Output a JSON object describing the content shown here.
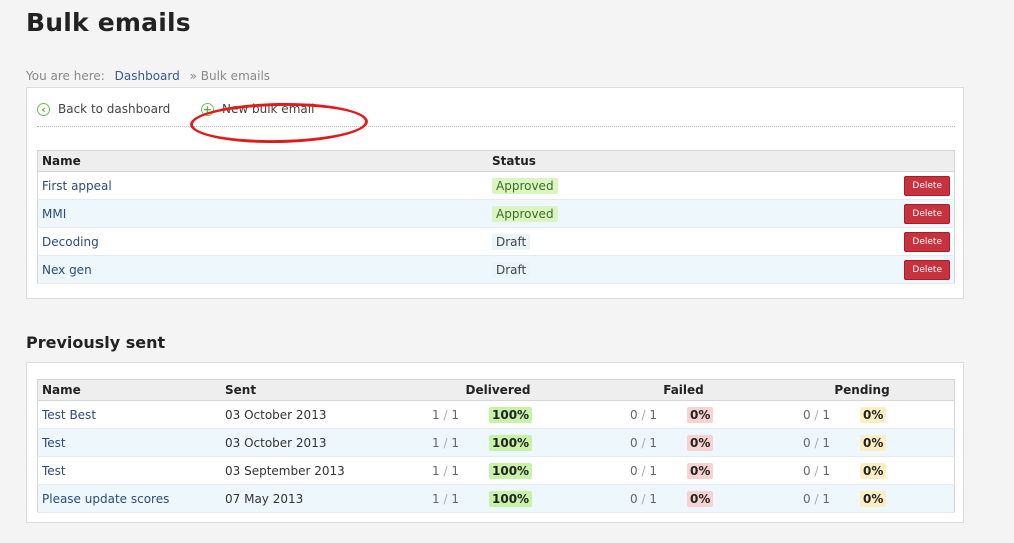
{
  "page": {
    "title": "Bulk emails"
  },
  "breadcrumb": {
    "prefix": "You are here:",
    "home": "Dashboard",
    "separator": "»",
    "current": "Bulk emails"
  },
  "actions": {
    "back_label": "Back to dashboard",
    "new_label": "New bulk email"
  },
  "drafts": {
    "headers": {
      "name": "Name",
      "status": "Status"
    },
    "delete_label": "Delete",
    "rows": [
      {
        "name": "First appeal",
        "status": "Approved"
      },
      {
        "name": "MMI",
        "status": "Approved"
      },
      {
        "name": "Decoding",
        "status": "Draft"
      },
      {
        "name": "Nex gen",
        "status": "Draft"
      }
    ]
  },
  "sent": {
    "title": "Previously sent",
    "headers": {
      "name": "Name",
      "sent": "Sent",
      "delivered": "Delivered",
      "failed": "Failed",
      "pending": "Pending"
    },
    "rows": [
      {
        "name": "Test Best",
        "date": "03 October 2013",
        "delivered_count": "1",
        "delivered_total": "1",
        "delivered_pct": "100%",
        "failed_count": "0",
        "failed_total": "1",
        "failed_pct": "0%",
        "pending_count": "0",
        "pending_total": "1",
        "pending_pct": "0%"
      },
      {
        "name": "Test",
        "date": "03 October 2013",
        "delivered_count": "1",
        "delivered_total": "1",
        "delivered_pct": "100%",
        "failed_count": "0",
        "failed_total": "1",
        "failed_pct": "0%",
        "pending_count": "0",
        "pending_total": "1",
        "pending_pct": "0%"
      },
      {
        "name": "Test",
        "date": "03 September 2013",
        "delivered_count": "1",
        "delivered_total": "1",
        "delivered_pct": "100%",
        "failed_count": "0",
        "failed_total": "1",
        "failed_pct": "0%",
        "pending_count": "0",
        "pending_total": "1",
        "pending_pct": "0%"
      },
      {
        "name": "Please update scores",
        "date": "07 May 2013",
        "delivered_count": "1",
        "delivered_total": "1",
        "delivered_pct": "100%",
        "failed_count": "0",
        "failed_total": "1",
        "failed_pct": "0%",
        "pending_count": "0",
        "pending_total": "1",
        "pending_pct": "0%"
      }
    ]
  },
  "colors": {
    "approved_bg": "#d9f5c2",
    "delete_bg": "#c8323f",
    "highlight_ellipse": "#e11b1b",
    "delivered_bg": "#c7f2a8",
    "failed_bg": "#f6d2d2",
    "pending_bg": "#faeec2"
  },
  "icons": {
    "back": "arrow-left-circle-icon",
    "new": "plus-circle-icon"
  }
}
